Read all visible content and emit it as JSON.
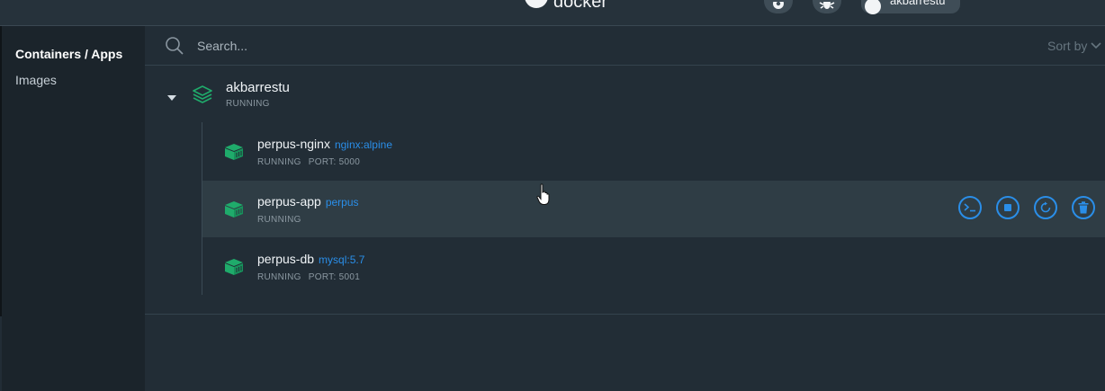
{
  "header": {
    "brand": "docker",
    "user": "akbarrestu"
  },
  "sidebar": {
    "items": [
      {
        "label": "Containers / Apps",
        "active": true
      },
      {
        "label": "Images",
        "active": false
      }
    ]
  },
  "search": {
    "placeholder": "Search...",
    "value": "",
    "sort_label": "Sort by"
  },
  "app": {
    "name": "akbarrestu",
    "status": "RUNNING",
    "expanded": true,
    "containers": [
      {
        "name": "perpus-nginx",
        "image": "nginx:alpine",
        "status": "RUNNING",
        "port": "PORT: 5000"
      },
      {
        "name": "perpus-app",
        "image": "perpus",
        "status": "RUNNING",
        "port": ""
      },
      {
        "name": "perpus-db",
        "image": "mysql:5.7",
        "status": "RUNNING",
        "port": "PORT: 5001"
      }
    ]
  },
  "row_actions": [
    {
      "icon": "cli-icon"
    },
    {
      "icon": "stop-icon"
    },
    {
      "icon": "restart-icon"
    },
    {
      "icon": "delete-icon"
    }
  ],
  "colors": {
    "accent": "#2a8ee8",
    "running_green": "#1fab6b",
    "sidebar_bg": "#1b242b",
    "main_bg": "#222d36",
    "hover_row_bg": "#2f3d45"
  }
}
